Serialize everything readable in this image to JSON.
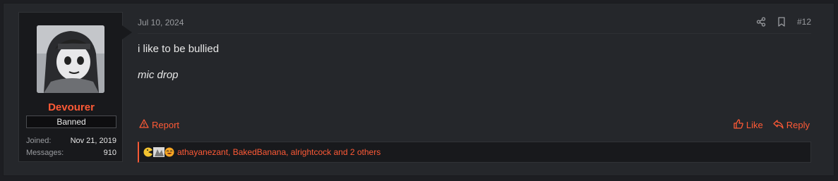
{
  "post": {
    "date": "Jul 10, 2024",
    "number": "#12",
    "content": {
      "line1": "i like to be bullied",
      "line2": "mic drop"
    }
  },
  "user": {
    "name": "Devourer",
    "badge": "Banned",
    "stats": [
      {
        "label": "Joined:",
        "value": "Nov 21, 2019"
      },
      {
        "label": "Messages:",
        "value": "910"
      }
    ]
  },
  "actions": {
    "report": "Report",
    "like": "Like",
    "reply": "Reply"
  },
  "reactions": {
    "text": "athayanezant, BakedBanana, alrightcock and 2 others"
  },
  "colors": {
    "accent": "#ff5a36",
    "background": "#1d1e22",
    "panel": "#25272b"
  }
}
